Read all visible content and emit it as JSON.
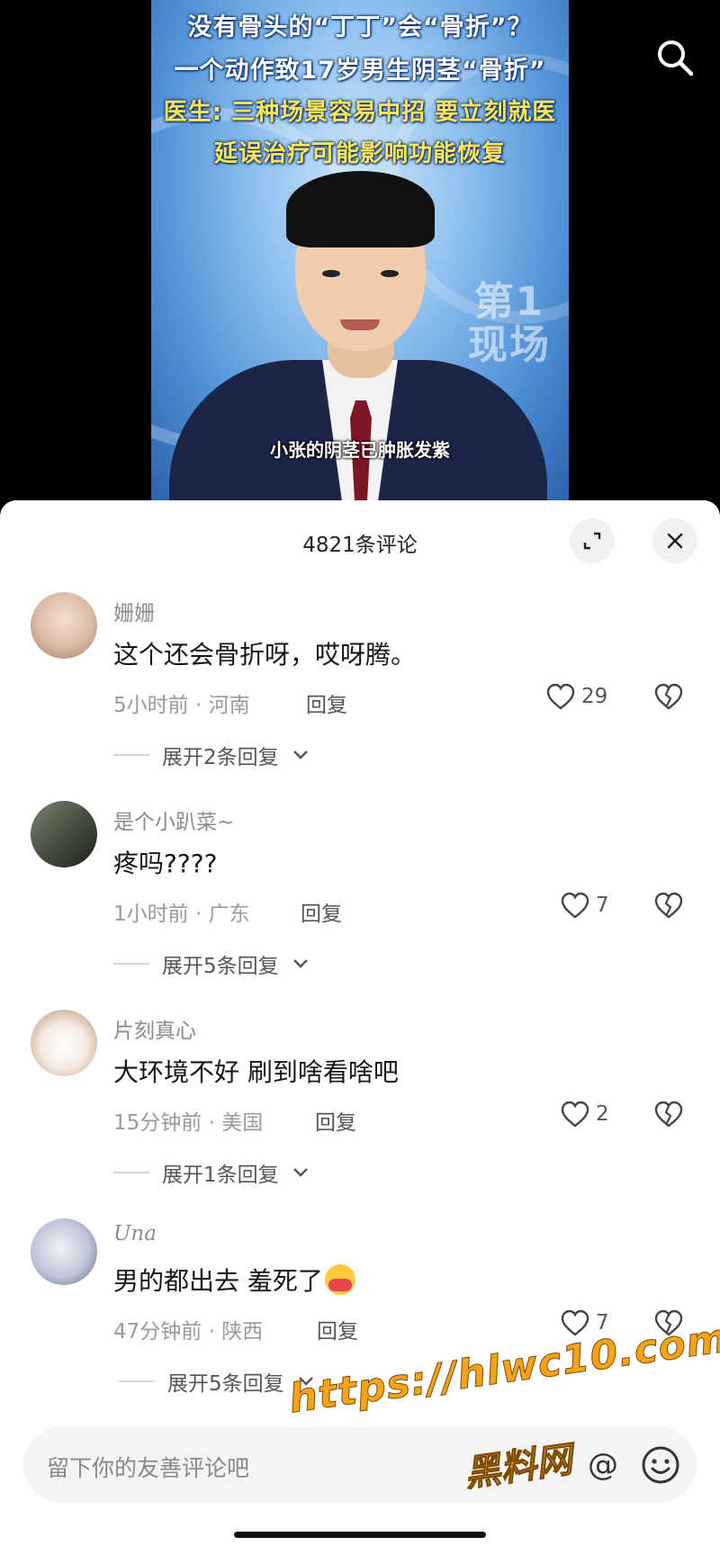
{
  "video": {
    "headline_lines": [
      "没有骨头的“丁丁”会“骨折”？",
      "一个动作致17岁男生阴茎“骨折”",
      "医生: 三种场景容易中招 要立刻就医",
      "延误治疗可能影响功能恢复"
    ],
    "station_logo": [
      "第1",
      "现场"
    ],
    "subtitle": "小张的阴茎已肿胀发紫",
    "search_icon": "search-icon"
  },
  "comments_panel": {
    "title": "4821条评论",
    "expand_icon": "expand-icon",
    "close_icon": "close-icon",
    "reply_label": "回复",
    "comments": [
      {
        "user": "姗姗",
        "text": "这个还会骨折呀，哎呀腾。",
        "time": "5小时前",
        "location": "河南",
        "likes": "29",
        "expand": "展开2条回复",
        "avatar_color": "#d9b9a4"
      },
      {
        "user": "是个小趴菜~",
        "text": "疼吗????",
        "time": "1小时前",
        "location": "广东",
        "likes": "7",
        "expand": "展开5条回复",
        "avatar_color": "#4f5a4c"
      },
      {
        "user": "片刻真心",
        "text": "大环境不好 刷到啥看啥吧",
        "time": "15分钟前",
        "location": "美国",
        "likes": "2",
        "expand": "展开1条回复",
        "avatar_color": "#e9dcd0"
      },
      {
        "user": "Una",
        "text": "男的都出去 羞死了",
        "time": "47分钟前",
        "location": "陕西",
        "likes": "7",
        "expand": "展开5条回复",
        "avatar_color": "#bfc4d8",
        "emoji": "hugging-face-emoji"
      }
    ],
    "input": {
      "placeholder": "留下你的友善评论吧",
      "at_label": "@",
      "emoji_icon": "smiley-icon"
    }
  },
  "watermark": {
    "url": "https://hlwc10.com",
    "name": "黑料网"
  }
}
